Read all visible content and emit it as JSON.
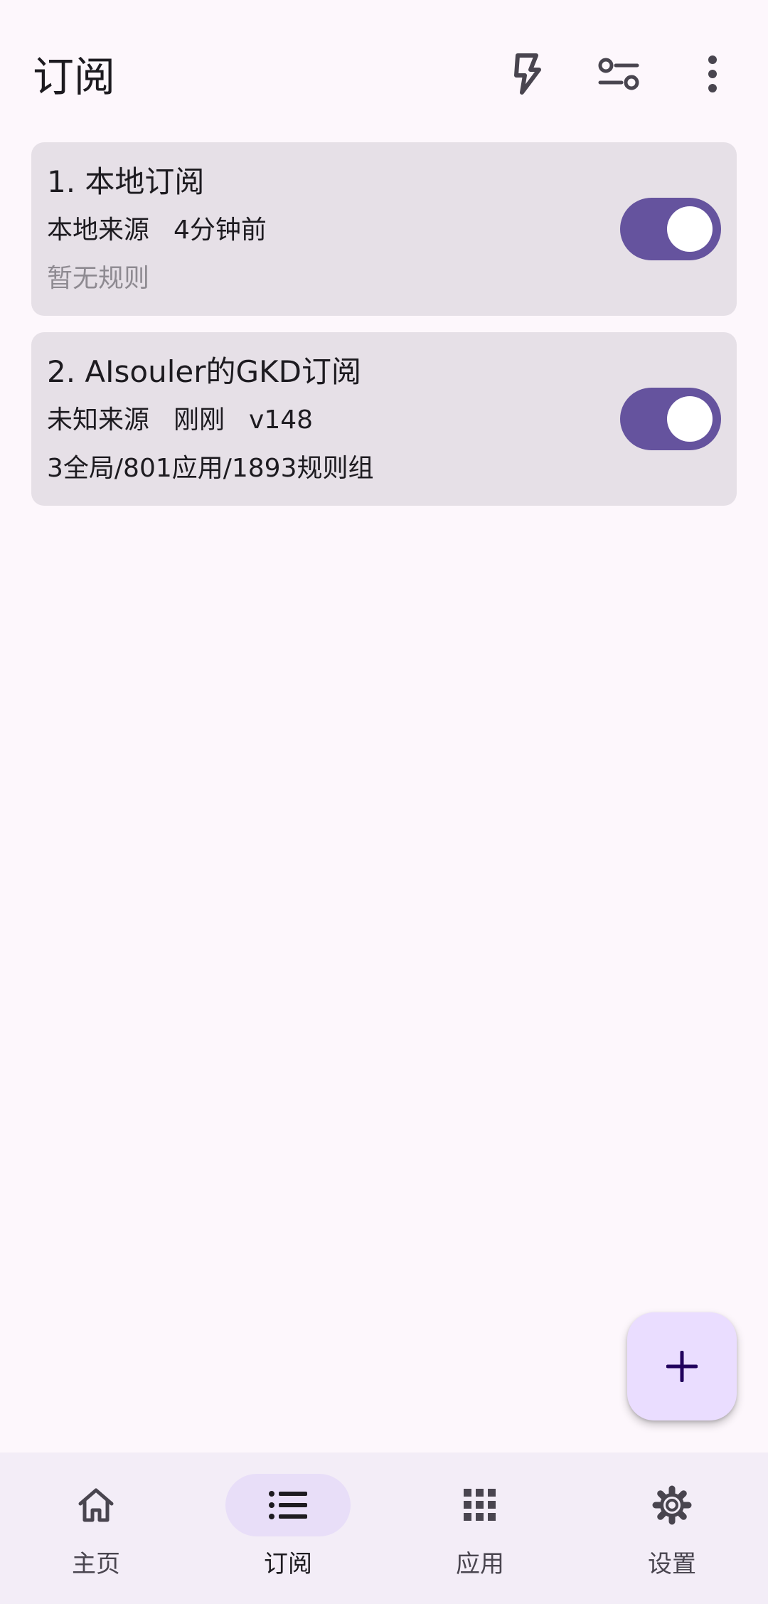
{
  "header": {
    "title": "订阅",
    "icons": [
      "lightning-bolt-icon",
      "filter-sliders-icon",
      "more-vert-icon"
    ]
  },
  "subscriptions": [
    {
      "title": "1. 本地订阅",
      "source": "本地来源",
      "time": "4分钟前",
      "version": "",
      "rules": "暂无规则",
      "enabled": true
    },
    {
      "title": "2. AIsouler的GKD订阅",
      "source": "未知来源",
      "time": "刚刚",
      "version": "v148",
      "rules": "3全局/801应用/1893规则组",
      "enabled": true
    }
  ],
  "fab": {
    "icon": "plus-icon"
  },
  "nav": {
    "items": [
      {
        "label": "主页",
        "icon": "home-icon",
        "active": false
      },
      {
        "label": "订阅",
        "icon": "list-icon",
        "active": true
      },
      {
        "label": "应用",
        "icon": "apps-grid-icon",
        "active": false
      },
      {
        "label": "设置",
        "icon": "gear-icon",
        "active": false
      }
    ]
  },
  "colors": {
    "background": "#fdf7fc",
    "card": "#e6e0e7",
    "switch_track": "#65539e",
    "fab": "#eaddff",
    "nav_background": "#f3edf7",
    "nav_active_pill": "#e8def8"
  }
}
